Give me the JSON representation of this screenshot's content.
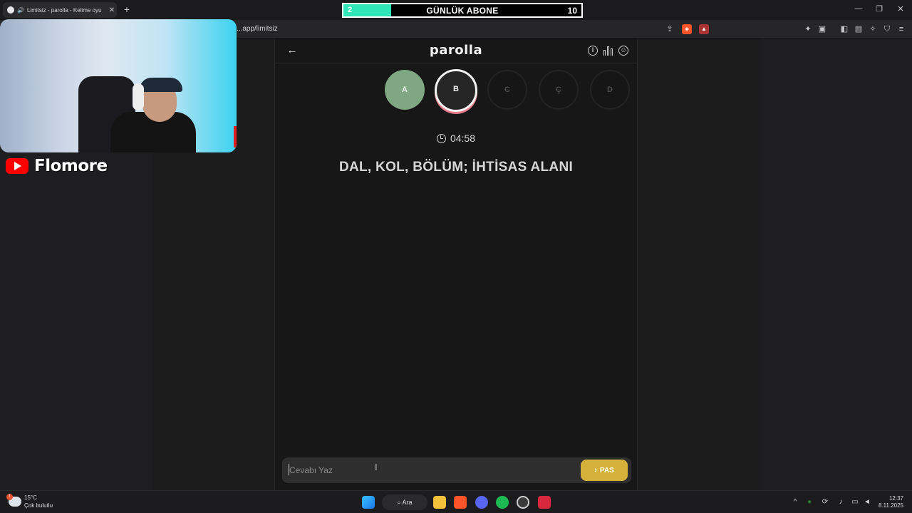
{
  "browser": {
    "tab_title": "Limitsiz - parolla - Kelime oyu",
    "url": "...app/limitsiz"
  },
  "overlay": {
    "sub_current": "2",
    "sub_label": "GÜNLÜK ABONE",
    "sub_goal": "10",
    "sub_progress": 0.2,
    "channel_name": "Flomore"
  },
  "app": {
    "title": "parolla",
    "letters": [
      {
        "letter": "A",
        "state": "done"
      },
      {
        "letter": "B",
        "state": "active"
      },
      {
        "letter": "C",
        "state": "pending"
      },
      {
        "letter": "Ç",
        "state": "pending"
      },
      {
        "letter": "D",
        "state": "pending"
      }
    ],
    "timer": "04:58",
    "question": "DAL, KOL, BÖLÜM; İHTİSAS ALANI",
    "answer_placeholder": "Cevabı Yaz",
    "answer_value": "",
    "pass_label": "PAS",
    "colors": {
      "done": "#7fa882",
      "active_ring": "#e77a8a",
      "pass_button": "#d4b13a"
    }
  },
  "taskbar": {
    "temperature": "15°C",
    "weather_desc": "Çok bulutlu",
    "search_label": "Ara",
    "time": "12:37",
    "date": "8.11.2025"
  }
}
